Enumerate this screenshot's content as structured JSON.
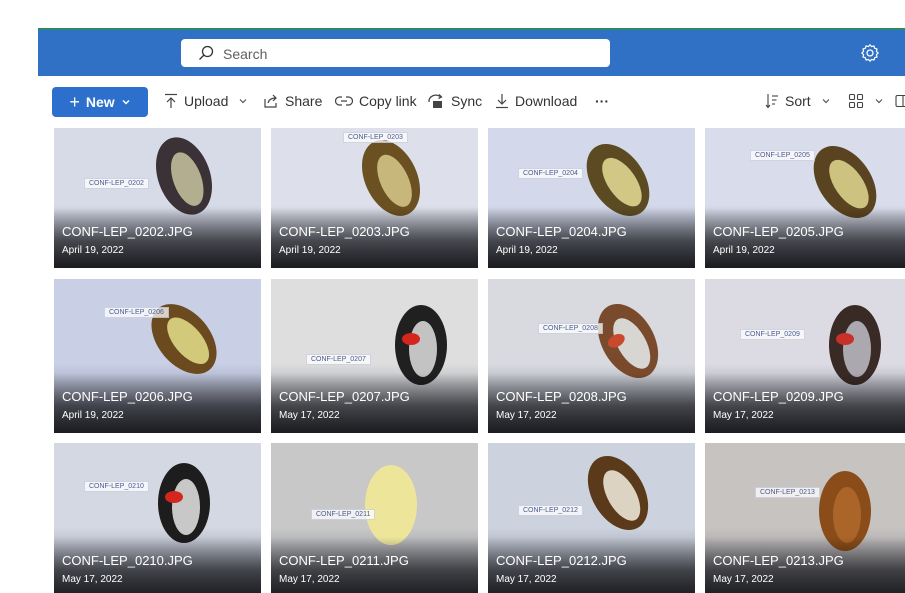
{
  "header": {
    "search": {
      "placeholder": "Search",
      "icon": "search-icon"
    },
    "settings_icon": "gear-icon"
  },
  "toolbar": {
    "new_label": "New",
    "upload_label": "Upload",
    "share_label": "Share",
    "copylink_label": "Copy link",
    "sync_label": "Sync",
    "download_label": "Download",
    "more_label": "···",
    "sort_label": "Sort"
  },
  "colors": {
    "header_bg": "#3070c5",
    "accent": "#2c6fcc"
  },
  "files": [
    {
      "name": "CONF-LEP_0202.JPG",
      "date": "April 19, 2022",
      "tag": "CONF-LEP_0202"
    },
    {
      "name": "CONF-LEP_0203.JPG",
      "date": "April 19, 2022",
      "tag": "CONF-LEP_0203"
    },
    {
      "name": "CONF-LEP_0204.JPG",
      "date": "April 19, 2022",
      "tag": "CONF-LEP_0204"
    },
    {
      "name": "CONF-LEP_0205.JPG",
      "date": "April 19, 2022",
      "tag": "CONF-LEP_0205"
    },
    {
      "name": "CONF-LEP_0206.JPG",
      "date": "April 19, 2022",
      "tag": "CONF-LEP_0206"
    },
    {
      "name": "CONF-LEP_0207.JPG",
      "date": "May 17, 2022",
      "tag": "CONF-LEP_0207"
    },
    {
      "name": "CONF-LEP_0208.JPG",
      "date": "May 17, 2022",
      "tag": "CONF-LEP_0208"
    },
    {
      "name": "CONF-LEP_0209.JPG",
      "date": "May 17, 2022",
      "tag": "CONF-LEP_0209"
    },
    {
      "name": "CONF-LEP_0210.JPG",
      "date": "May 17, 2022",
      "tag": "CONF-LEP_0210"
    },
    {
      "name": "CONF-LEP_0211.JPG",
      "date": "May 17, 2022",
      "tag": "CONF-LEP_0211"
    },
    {
      "name": "CONF-LEP_0212.JPG",
      "date": "May 17, 2022",
      "tag": "CONF-LEP_0212"
    },
    {
      "name": "CONF-LEP_0213.JPG",
      "date": "May 17, 2022",
      "tag": "CONF-LEP_0213"
    }
  ]
}
